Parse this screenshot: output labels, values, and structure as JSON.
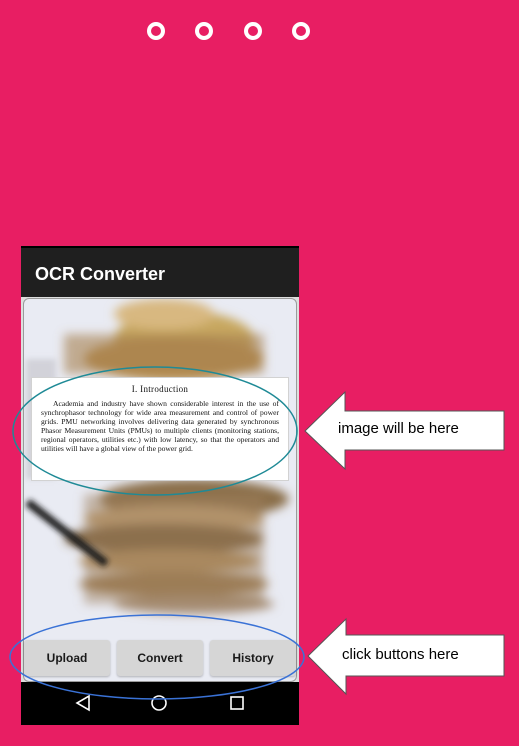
{
  "page_indicator": {
    "dots": [
      "dot-1",
      "dot-2",
      "dot-3",
      "dot-4"
    ]
  },
  "app": {
    "title": "OCR Converter"
  },
  "document_preview": {
    "heading": "I. Introduction",
    "body": "Academia and industry have shown considerable interest in the use of synchrophasor technology for wide area measurement and control of power grids. PMU networking involves delivering data generated by synchronous Phasor Measurement Units (PMUs) to multiple clients (monitoring stations, regional operators, utilities etc.) with low latency, so that the operators and utilities will have a global view of the power grid."
  },
  "buttons": {
    "upload": "Upload",
    "convert": "Convert",
    "history": "History"
  },
  "navigation": {
    "back_icon": "back-triangle-icon",
    "home_icon": "home-circle-icon",
    "recents_icon": "recents-square-icon"
  },
  "annotations": {
    "image_callout": "image will be here",
    "buttons_callout": "click buttons here"
  },
  "colors": {
    "background": "#e81e63",
    "appbar": "#1f1f1f",
    "image_highlight": "#1f8a96",
    "buttons_highlight": "#3a72d6"
  }
}
